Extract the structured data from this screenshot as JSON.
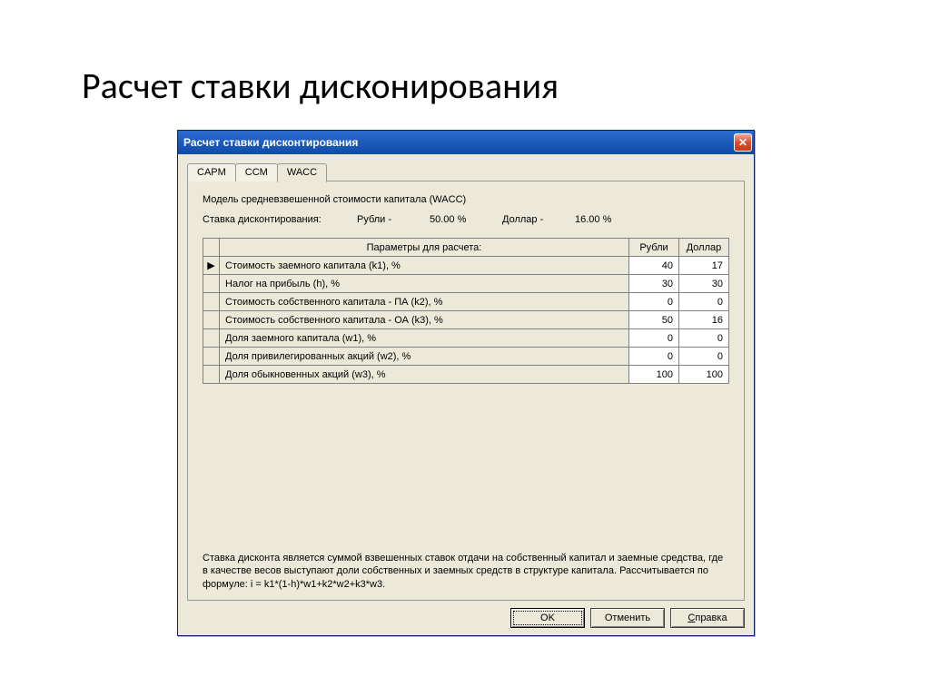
{
  "slide_title": "Расчет ставки дисконирования",
  "window": {
    "title": "Расчет ставки дисконтирования",
    "tabs": [
      {
        "label": "CAPM"
      },
      {
        "label": "CCM"
      },
      {
        "label": "WACC"
      }
    ],
    "active_tab": 2,
    "model_title": "Модель средневзвешенной стоимости капитала (WACC)",
    "rate_label": "Ставка дисконтирования:",
    "currencies": [
      {
        "name": "Рубли -",
        "value": "50.00 %"
      },
      {
        "name": "Доллар -",
        "value": "16.00 %"
      }
    ],
    "columns": {
      "param": "Параметры для расчета:",
      "rub": "Рубли",
      "usd": "Доллар"
    },
    "rows": [
      {
        "selected": true,
        "param": "Стоимость заемного капитала (k1), %",
        "rub": "40",
        "usd": "17"
      },
      {
        "selected": false,
        "param": "Налог на прибыль (h), %",
        "rub": "30",
        "usd": "30"
      },
      {
        "selected": false,
        "param": "Стоимость собственного капитала - ПА (k2), %",
        "rub": "0",
        "usd": "0"
      },
      {
        "selected": false,
        "param": "Стоимость собственного капитала - ОА (k3), %",
        "rub": "50",
        "usd": "16"
      },
      {
        "selected": false,
        "param": "Доля заемного капитала (w1), %",
        "rub": "0",
        "usd": "0"
      },
      {
        "selected": false,
        "param": "Доля привилегированных акций (w2), %",
        "rub": "0",
        "usd": "0"
      },
      {
        "selected": false,
        "param": "Доля обыкновенных акций (w3), %",
        "rub": "100",
        "usd": "100"
      }
    ],
    "description": "Ставка дисконта является суммой взвешенных ставок отдачи на собственный капитал и заемные средства, где в качестве весов выступают доли собственных и заемных средств в структуре капитала. Рассчитывается по формуле: i = k1*(1-h)*w1+k2*w2+k3*w3.",
    "buttons": {
      "ok": "OK",
      "cancel": "Отменить",
      "help": "Справка"
    }
  }
}
